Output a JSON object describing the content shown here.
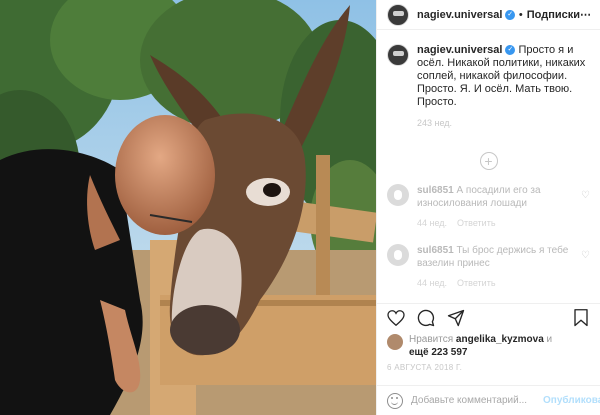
{
  "post": {
    "username": "nagiev.universal",
    "verified_icon": "verified-badge-icon",
    "separator": "•",
    "follow_label": "Подписки",
    "more_icon": "more-horizontal-icon",
    "photo_alt": "man-with-donkey-photo"
  },
  "caption": {
    "username": "nagiev.universal",
    "text": "Просто я и осёл. Никакой политики, никаких соплей, никакой философии. Просто. Я. И осёл. Мать твою. Просто.",
    "time": "243 нед."
  },
  "load_more_icon": "plus-circle-icon",
  "comments": [
    {
      "username": "sul6851",
      "text": "А посадили его за износилования лошади",
      "time": "44 нед.",
      "reply": "Ответить"
    },
    {
      "username": "sul6851",
      "text": "Ты брос держись я тебе вазелин принес",
      "time": "44 нед.",
      "reply": "Ответить"
    }
  ],
  "likes": {
    "prefix": "Нравится",
    "user": "angelika_kyzmova",
    "mid": "и",
    "more": "ещё 223 597"
  },
  "date": "6 АВГУСТА 2018 Г.",
  "add_comment": {
    "placeholder": "Добавьте комментарий...",
    "publish_label": "Опубликовать"
  },
  "colors": {
    "accent": "#3897f0",
    "publish_disabled": "#b2dffc"
  }
}
